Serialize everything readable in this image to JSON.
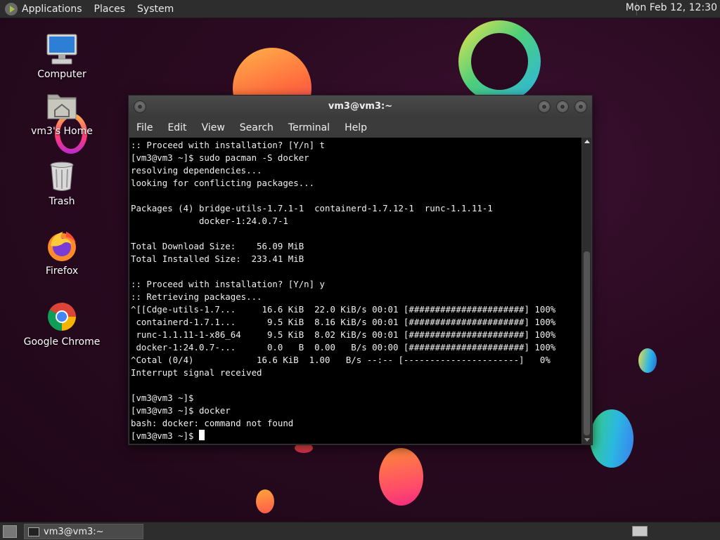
{
  "top_panel": {
    "menus": [
      "Applications",
      "Places",
      "System"
    ],
    "clock": "Mon Feb 12, 12:30"
  },
  "desktop": {
    "icons": [
      {
        "label": "Computer",
        "icon": "computer-icon"
      },
      {
        "label": "vm3's Home",
        "icon": "home-folder-icon"
      },
      {
        "label": "Trash",
        "icon": "trash-icon"
      },
      {
        "label": "Firefox",
        "icon": "firefox-icon"
      },
      {
        "label": "Google Chrome",
        "icon": "chrome-icon"
      }
    ]
  },
  "terminal": {
    "title": "vm3@vm3:~",
    "menu": [
      "File",
      "Edit",
      "View",
      "Search",
      "Terminal",
      "Help"
    ],
    "output": ":: Proceed with installation? [Y/n] t\n[vm3@vm3 ~]$ sudo pacman -S docker\nresolving dependencies...\nlooking for conflicting packages...\n\nPackages (4) bridge-utils-1.7.1-1  containerd-1.7.12-1  runc-1.1.11-1\n             docker-1:24.0.7-1\n\nTotal Download Size:    56.09 MiB\nTotal Installed Size:  233.41 MiB\n\n:: Proceed with installation? [Y/n] y\n:: Retrieving packages...\n^[[Cdge-utils-1.7...     16.6 KiB  22.0 KiB/s 00:01 [######################] 100%\n containerd-1.7.1...      9.5 KiB  8.16 KiB/s 00:01 [######################] 100%\n runc-1.1.11-1-x86_64     9.5 KiB  8.02 KiB/s 00:01 [######################] 100%\n docker-1:24.0.7-...      0.0   B  0.00   B/s 00:00 [######################] 100%\n^Cotal (0/4)            16.6 KiB  1.00   B/s --:-- [----------------------]   0%\nInterrupt signal received\n\n[vm3@vm3 ~]$\n[vm3@vm3 ~]$ docker\nbash: docker: command not found\n",
    "prompt": "[vm3@vm3 ~]$ "
  },
  "taskbar": {
    "task_label": "vm3@vm3:~"
  }
}
